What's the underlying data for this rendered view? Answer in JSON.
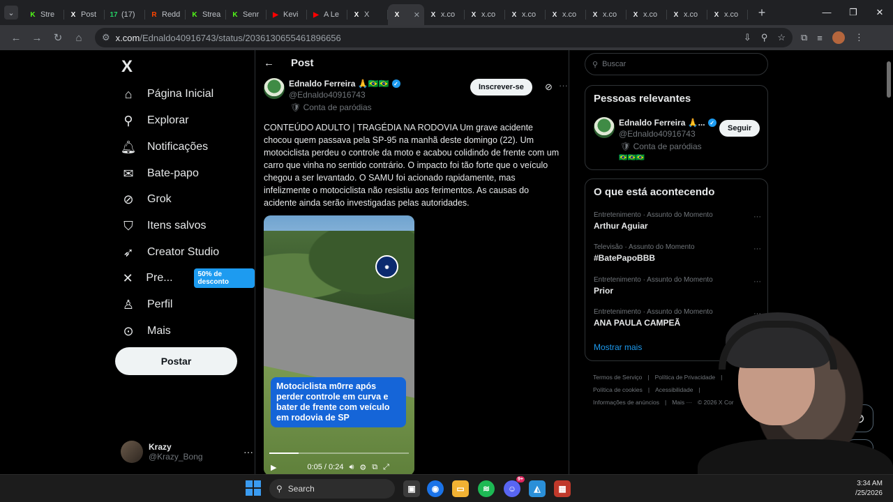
{
  "browser": {
    "tabs": [
      {
        "label": "Stre",
        "favicon": "K",
        "color": "#53fc18"
      },
      {
        "label": "Post",
        "favicon": "X",
        "color": "#ffffff"
      },
      {
        "label": "(17)",
        "favicon": "17",
        "color": "#25d366"
      },
      {
        "label": "Redd",
        "favicon": "R",
        "color": "#ff4500"
      },
      {
        "label": "Strea",
        "favicon": "K",
        "color": "#53fc18"
      },
      {
        "label": "Senr",
        "favicon": "K",
        "color": "#53fc18"
      },
      {
        "label": "Kevi",
        "favicon": "▶",
        "color": "#ff0000"
      },
      {
        "label": "A Le",
        "favicon": "▶",
        "color": "#ff0000"
      },
      {
        "label": "X",
        "favicon": "X",
        "color": "#ffffff"
      }
    ],
    "active_tab": {
      "label": "",
      "favicon": "X"
    },
    "tabs_after": [
      {
        "label": "x.co",
        "favicon": "X"
      },
      {
        "label": "x.co",
        "favicon": "X"
      },
      {
        "label": "x.co",
        "favicon": "X"
      },
      {
        "label": "x.co",
        "favicon": "X"
      },
      {
        "label": "x.co",
        "favicon": "X"
      },
      {
        "label": "x.co",
        "favicon": "X"
      },
      {
        "label": "x.co",
        "favicon": "X"
      },
      {
        "label": "x.co",
        "favicon": "X"
      }
    ],
    "url_host": "x.com",
    "url_path": "/Ednaldo40916743/status/2036130655461896656"
  },
  "leftnav": {
    "logo": "X",
    "items": [
      {
        "label": "Página Inicial",
        "icon": "home-icon",
        "glyph": "⌂"
      },
      {
        "label": "Explorar",
        "icon": "search-icon",
        "glyph": "⚲"
      },
      {
        "label": "Notificações",
        "icon": "bell-icon",
        "glyph": "🔔︎"
      },
      {
        "label": "Bate-papo",
        "icon": "mail-icon",
        "glyph": "✉"
      },
      {
        "label": "Grok",
        "icon": "grok-icon",
        "glyph": "⊘"
      },
      {
        "label": "Itens salvos",
        "icon": "bookmark-icon",
        "glyph": "⛉"
      },
      {
        "label": "Creator Studio",
        "icon": "rocket-icon",
        "glyph": "➶"
      },
      {
        "label": "Pre...",
        "icon": "x-premium-icon",
        "glyph": "✕"
      },
      {
        "label": "Perfil",
        "icon": "person-icon",
        "glyph": "♙"
      },
      {
        "label": "Mais",
        "icon": "more-circle-icon",
        "glyph": "⊙"
      }
    ],
    "premium_badge": "50% de desconto",
    "post_button": "Postar",
    "account": {
      "name": "Krazy",
      "handle": "@Krazy_Bong"
    }
  },
  "post": {
    "header": "Post",
    "author_name": "Ednaldo Ferreira 🙏🇧🇷🇧🇷",
    "author_handle": "@Ednaldo40916743",
    "parody_label": "Conta de paródias",
    "subscribe_button": "Inscrever-se",
    "text": "CONTEÚDO ADULTO | TRAGÉDIA NA RODOVIA Um grave acidente chocou quem passava pela SP-95 na manhã deste domingo (22). Um motociclista perdeu o controle da moto e acabou colidindo de frente com um carro que vinha no sentido contrário. O impacto foi tão forte que o veículo chegou a ser levantado. O SAMU foi acionado rapidamente, mas infelizmente o motociclista não resistiu aos ferimentos. As causas do acidente ainda serão investigadas pelas autoridades.",
    "video": {
      "caption": "Motociclista m0rre após perder controle em curva e bater de frente com veículo em rodovia de SP",
      "time": "0:05 / 0:24",
      "progress": 0.21
    }
  },
  "rightcol": {
    "search_placeholder": "Buscar",
    "relevant": {
      "title": "Pessoas relevantes",
      "name": "Ednaldo Ferreira 🙏...",
      "handle": "@Ednaldo40916743",
      "parody_label": "Conta de paródias",
      "flags": "🇧🇷🇧🇷🇧🇷",
      "follow_button": "Seguir"
    },
    "trending": {
      "title": "O que está acontecendo",
      "items": [
        {
          "category": "Entretenimento · Assunto do Momento",
          "name": "Arthur Aguiar"
        },
        {
          "category": "Televisão · Assunto do Momento",
          "name": "#BatePapoBBB"
        },
        {
          "category": "Entretenimento · Assunto do Momento",
          "name": "Prior"
        },
        {
          "category": "Entretenimento · Assunto do Momento",
          "name": "ANA PAULA CAMPEÃ"
        }
      ],
      "show_more": "Mostrar mais"
    },
    "footer": {
      "line1": [
        "Termos de Serviço",
        "|",
        "Política de Privacidade",
        "|"
      ],
      "line2": [
        "Política de cookies",
        "|",
        "Acessibilidade",
        "|"
      ],
      "line3": [
        "Informações de anúncios",
        "|",
        "Mais ···",
        "© 2026 X Cor"
      ]
    }
  },
  "taskbar": {
    "search_label": "Search",
    "discord_badge": "9+",
    "time": "3:34 AM",
    "date": "/25/2026"
  }
}
